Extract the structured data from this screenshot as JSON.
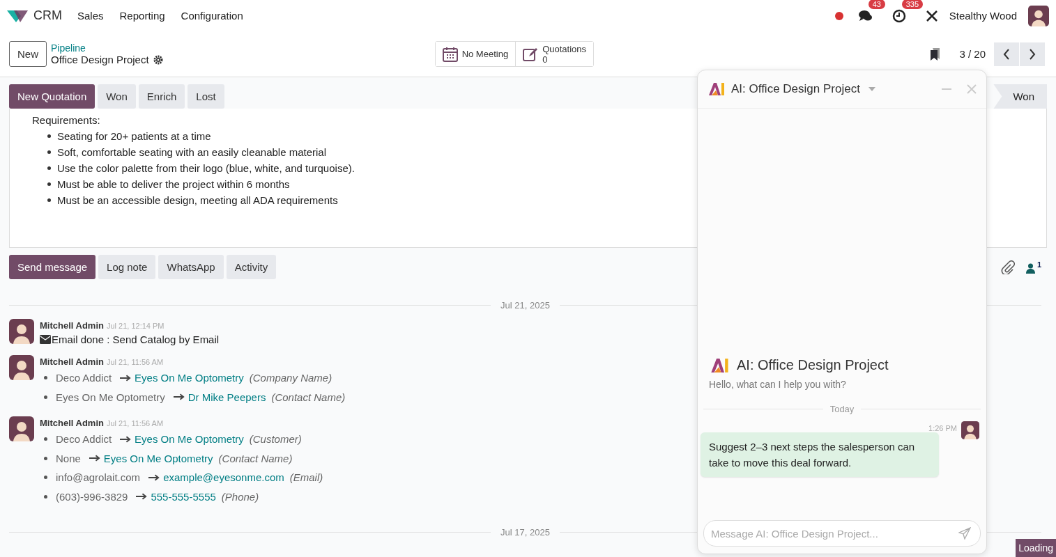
{
  "nav": {
    "app": "CRM",
    "menu": [
      "Sales",
      "Reporting",
      "Configuration"
    ],
    "recording": true,
    "messages_badge": "43",
    "activities_badge": "335",
    "user": "Stealthy Wood"
  },
  "control": {
    "new": "New",
    "breadcrumb": "Pipeline",
    "title": "Office Design Project",
    "smart_buttons": [
      {
        "kind": "calendar",
        "label": "No Meeting"
      },
      {
        "kind": "edit",
        "label": "Quotations",
        "value": "0"
      }
    ],
    "pager": "3 / 20"
  },
  "actions": [
    {
      "label": "New Quotation",
      "primary": true
    },
    {
      "label": "Won",
      "primary": false
    },
    {
      "label": "Enrich",
      "primary": false
    },
    {
      "label": "Lost",
      "primary": false
    }
  ],
  "stage": "Won",
  "description": {
    "heading": "Requirements:",
    "items": [
      "Seating for 20+ patients at a time",
      "Soft, comfortable seating with an easily cleanable material",
      "Use the color palette from their logo (blue, white, and turquoise).",
      "Must be able to deliver the project within 6 months",
      "Must be an accessible design, meeting all ADA requirements"
    ]
  },
  "chatter_buttons": [
    {
      "label": "Send message",
      "primary": true
    },
    {
      "label": "Log note",
      "primary": false
    },
    {
      "label": "WhatsApp",
      "primary": false
    },
    {
      "label": "Activity",
      "primary": false
    }
  ],
  "followers_count": "1",
  "feed": [
    {
      "kind": "separator",
      "text": "Jul 21, 2025"
    },
    {
      "kind": "message",
      "author": "Mitchell Admin",
      "time": "Jul 21, 12:14 PM",
      "body": "Email done : Send Catalog by Email"
    },
    {
      "kind": "message",
      "author": "Mitchell Admin",
      "time": "Jul 21, 11:56 AM",
      "changes": [
        {
          "old": "Deco Addict",
          "new": "Eyes On Me Optometry",
          "field": "(Company Name)"
        },
        {
          "old": "Eyes On Me Optometry",
          "new": "Dr Mike Peepers",
          "field": "(Contact Name)"
        }
      ]
    },
    {
      "kind": "message",
      "author": "Mitchell Admin",
      "time": "Jul 21, 11:56 AM",
      "changes": [
        {
          "old": "Deco Addict",
          "new": "Eyes On Me Optometry",
          "field": "(Customer)"
        },
        {
          "old": "None",
          "new": "Eyes On Me Optometry",
          "field": "(Contact Name)"
        },
        {
          "old": "info@agrolait.com",
          "new": "example@eyesonme.com",
          "field": "(Email)"
        },
        {
          "old": "(603)-996-3829",
          "new": "555-555-5555",
          "field": "(Phone)"
        }
      ]
    },
    {
      "kind": "separator",
      "text": "Jul 17, 2025"
    }
  ],
  "ai_chat": {
    "title": "AI: Office Design Project",
    "intro_title": "AI: Office Design Project",
    "greeting": "Hello, what can I help you with?",
    "day": "Today",
    "messages": [
      {
        "time": "1:26 PM",
        "text": "Suggest 2–3 next steps the salesperson can take to move this deal forward."
      }
    ],
    "placeholder": "Message AI: Office Design Project..."
  },
  "loading": "Loading"
}
